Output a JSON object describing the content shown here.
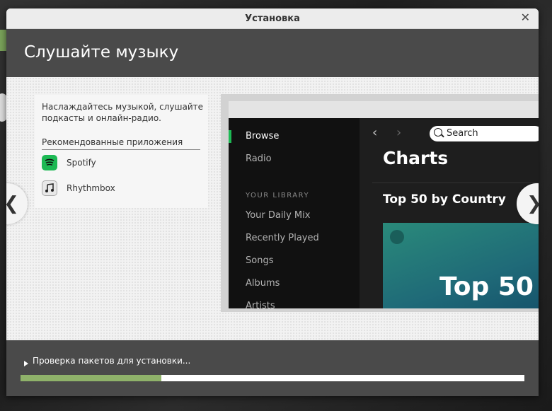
{
  "window": {
    "title": "Установка",
    "close_icon": "close-icon"
  },
  "header": {
    "title": "Слушайте музыку"
  },
  "info": {
    "description": "Наслаждайтесь музыкой, слушайте подкасты и онлайн-радио.",
    "recommended_title": "Рекомендованные приложения",
    "apps": [
      {
        "name": "Spotify",
        "icon": "spotify-icon"
      },
      {
        "name": "Rhythmbox",
        "icon": "music-note-icon"
      }
    ]
  },
  "screenshot": {
    "sidebar": {
      "items": [
        "Browse",
        "Radio"
      ],
      "library_label": "YOUR LIBRARY",
      "library_items": [
        "Your Daily Mix",
        "Recently Played",
        "Songs",
        "Albums",
        "Artists"
      ]
    },
    "search_placeholder": "Search",
    "charts_title": "Charts",
    "section_title": "Top 50 by Country",
    "tile_text": "Top 50"
  },
  "nav": {
    "prev": "❮",
    "next": "❯"
  },
  "footer": {
    "status": "Проверка пакетов для установки...",
    "progress": 0.28
  },
  "colors": {
    "accent": "#8fb26a",
    "header_bg": "#4a4a4a",
    "spotify_green": "#1db954"
  }
}
